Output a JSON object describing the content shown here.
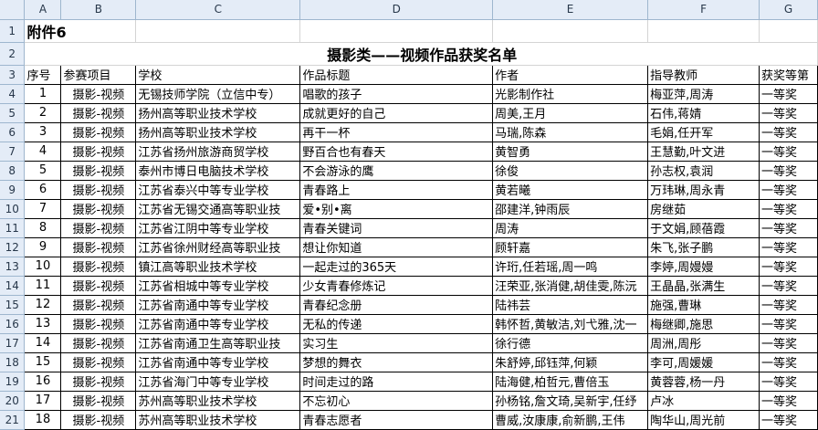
{
  "columns": [
    "A",
    "B",
    "C",
    "D",
    "E",
    "F",
    "G"
  ],
  "row1": {
    "row_num": "1",
    "text": "附件6"
  },
  "row2": {
    "row_num": "2",
    "text": "摄影类——视频作品获奖名单"
  },
  "row3": {
    "row_num": "3",
    "headers": [
      "序号",
      "参赛项目",
      "学校",
      "作品标题",
      "作者",
      "指导教师",
      "获奖等第"
    ]
  },
  "rows": [
    {
      "row_num": "4",
      "cells": [
        "1",
        "摄影-视频",
        "无锡技师学院（立信中专）",
        "唱歌的孩子",
        "光影制作社",
        "梅亚萍,周涛",
        "一等奖"
      ]
    },
    {
      "row_num": "5",
      "cells": [
        "2",
        "摄影-视频",
        "扬州高等职业技术学校",
        "成就更好的自己",
        "周美,王月",
        "石伟,蒋婧",
        "一等奖"
      ]
    },
    {
      "row_num": "6",
      "cells": [
        "3",
        "摄影-视频",
        "扬州高等职业技术学校",
        "再干一杯",
        "马瑞,陈森",
        "毛娟,任开军",
        "一等奖"
      ]
    },
    {
      "row_num": "7",
      "cells": [
        "4",
        "摄影-视频",
        "江苏省扬州旅游商贸学校",
        "野百合也有春天",
        "黄智勇",
        "王慧勤,叶文进",
        "一等奖"
      ]
    },
    {
      "row_num": "8",
      "cells": [
        "5",
        "摄影-视频",
        "泰州市博日电脑技术学校",
        "不会游泳的鹰",
        "徐俊",
        "孙志权,袁润",
        "一等奖"
      ]
    },
    {
      "row_num": "9",
      "cells": [
        "6",
        "摄影-视频",
        "江苏省泰兴中等专业学校",
        "青春路上",
        "黄若曦",
        "万玮琳,周永青",
        "一等奖"
      ]
    },
    {
      "row_num": "10",
      "cells": [
        "7",
        "摄影-视频",
        "江苏省无锡交通高等职业技",
        "爱•别•离",
        "邵建洋,钟雨辰",
        "房继茹",
        "一等奖"
      ]
    },
    {
      "row_num": "11",
      "cells": [
        "8",
        "摄影-视频",
        "江苏省江阴中等专业学校",
        "青春关键词",
        "周涛",
        "于文娟,顾蓓霞",
        "一等奖"
      ]
    },
    {
      "row_num": "12",
      "cells": [
        "9",
        "摄影-视频",
        "江苏省徐州财经高等职业技",
        "想让你知道",
        "顾轩嘉",
        "朱飞,张子鹏",
        "一等奖"
      ]
    },
    {
      "row_num": "13",
      "cells": [
        "10",
        "摄影-视频",
        "镇江高等职业技术学校",
        "一起走过的365天",
        "许珩,任若瑶,周一鸣",
        "李婷,周嫚嫚",
        "一等奖"
      ]
    },
    {
      "row_num": "14",
      "cells": [
        "11",
        "摄影-视频",
        "江苏省相城中等专业学校",
        "少女青春修炼记",
        "汪荣亚,张消健,胡佳雯,陈沅",
        "王晶晶,张满生",
        "一等奖"
      ]
    },
    {
      "row_num": "15",
      "cells": [
        "12",
        "摄影-视频",
        "江苏省南通中等专业学校",
        "青春纪念册",
        "陆祎芸",
        "施强,曹琳",
        "一等奖"
      ]
    },
    {
      "row_num": "16",
      "cells": [
        "13",
        "摄影-视频",
        "江苏省南通中等专业学校",
        "无私的传递",
        "韩怀哲,黄敏洁,刘弋雅,沈一",
        "梅继卿,施思",
        "一等奖"
      ]
    },
    {
      "row_num": "17",
      "cells": [
        "14",
        "摄影-视频",
        "江苏省南通卫生高等职业技",
        "实习生",
        "徐行德",
        "周洲,周彤",
        "一等奖"
      ]
    },
    {
      "row_num": "18",
      "cells": [
        "15",
        "摄影-视频",
        "江苏省南通中等专业学校",
        "梦想的舞衣",
        "朱舒婷,邱钰萍,何颖",
        "李可,周媛媛",
        "一等奖"
      ]
    },
    {
      "row_num": "19",
      "cells": [
        "16",
        "摄影-视频",
        "江苏省海门中等专业学校",
        "时间走过的路",
        "陆海健,柏哲元,曹倍玉",
        "黄蓉蓉,杨一丹",
        "一等奖"
      ]
    },
    {
      "row_num": "20",
      "cells": [
        "17",
        "摄影-视频",
        "苏州高等职业技术学校",
        "不忘初心",
        "孙杨铭,詹文琦,吴新宇,任纾",
        "卢冰",
        "一等奖"
      ]
    },
    {
      "row_num": "21",
      "cells": [
        "18",
        "摄影-视频",
        "苏州高等职业技术学校",
        "青春志愿者",
        "曹威,汝康康,俞新鹏,王伟",
        "陶华山,周光前",
        "一等奖"
      ]
    }
  ]
}
